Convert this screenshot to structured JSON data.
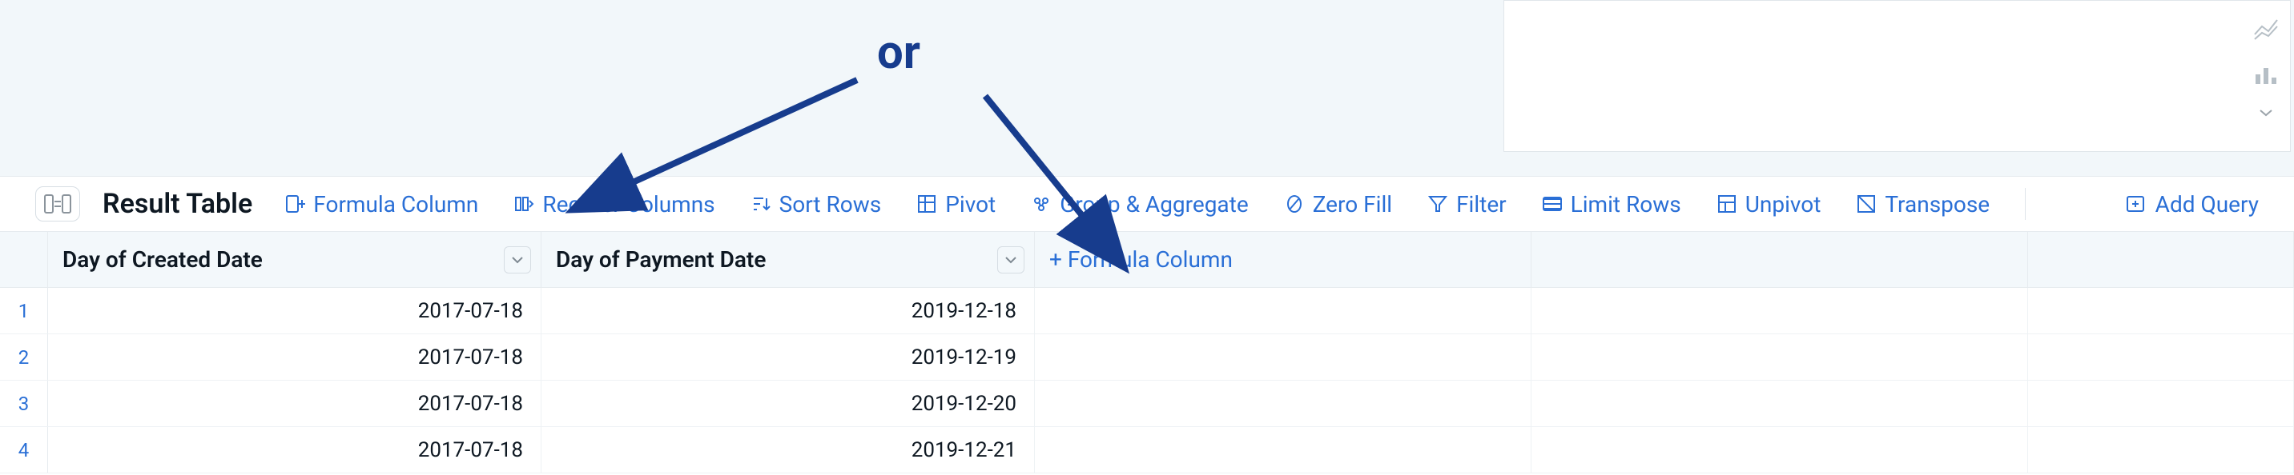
{
  "annotation": {
    "or_label": "or"
  },
  "toolbar": {
    "title": "Result Table",
    "formula_column": "Formula Column",
    "reorder_columns": "Reorder Columns",
    "sort_rows": "Sort Rows",
    "pivot": "Pivot",
    "group_aggregate": "Group & Aggregate",
    "zero_fill": "Zero Fill",
    "filter": "Filter",
    "limit_rows": "Limit Rows",
    "unpivot": "Unpivot",
    "transpose": "Transpose",
    "add_query": "Add Query"
  },
  "table": {
    "columns": {
      "created": "Day of Created Date",
      "payment": "Day of Payment Date",
      "add_formula": "+ Formula Column"
    },
    "rows": [
      {
        "n": "1",
        "created": "2017-07-18",
        "payment": "2019-12-18"
      },
      {
        "n": "2",
        "created": "2017-07-18",
        "payment": "2019-12-19"
      },
      {
        "n": "3",
        "created": "2017-07-18",
        "payment": "2019-12-20"
      },
      {
        "n": "4",
        "created": "2017-07-18",
        "payment": "2019-12-21"
      }
    ]
  }
}
